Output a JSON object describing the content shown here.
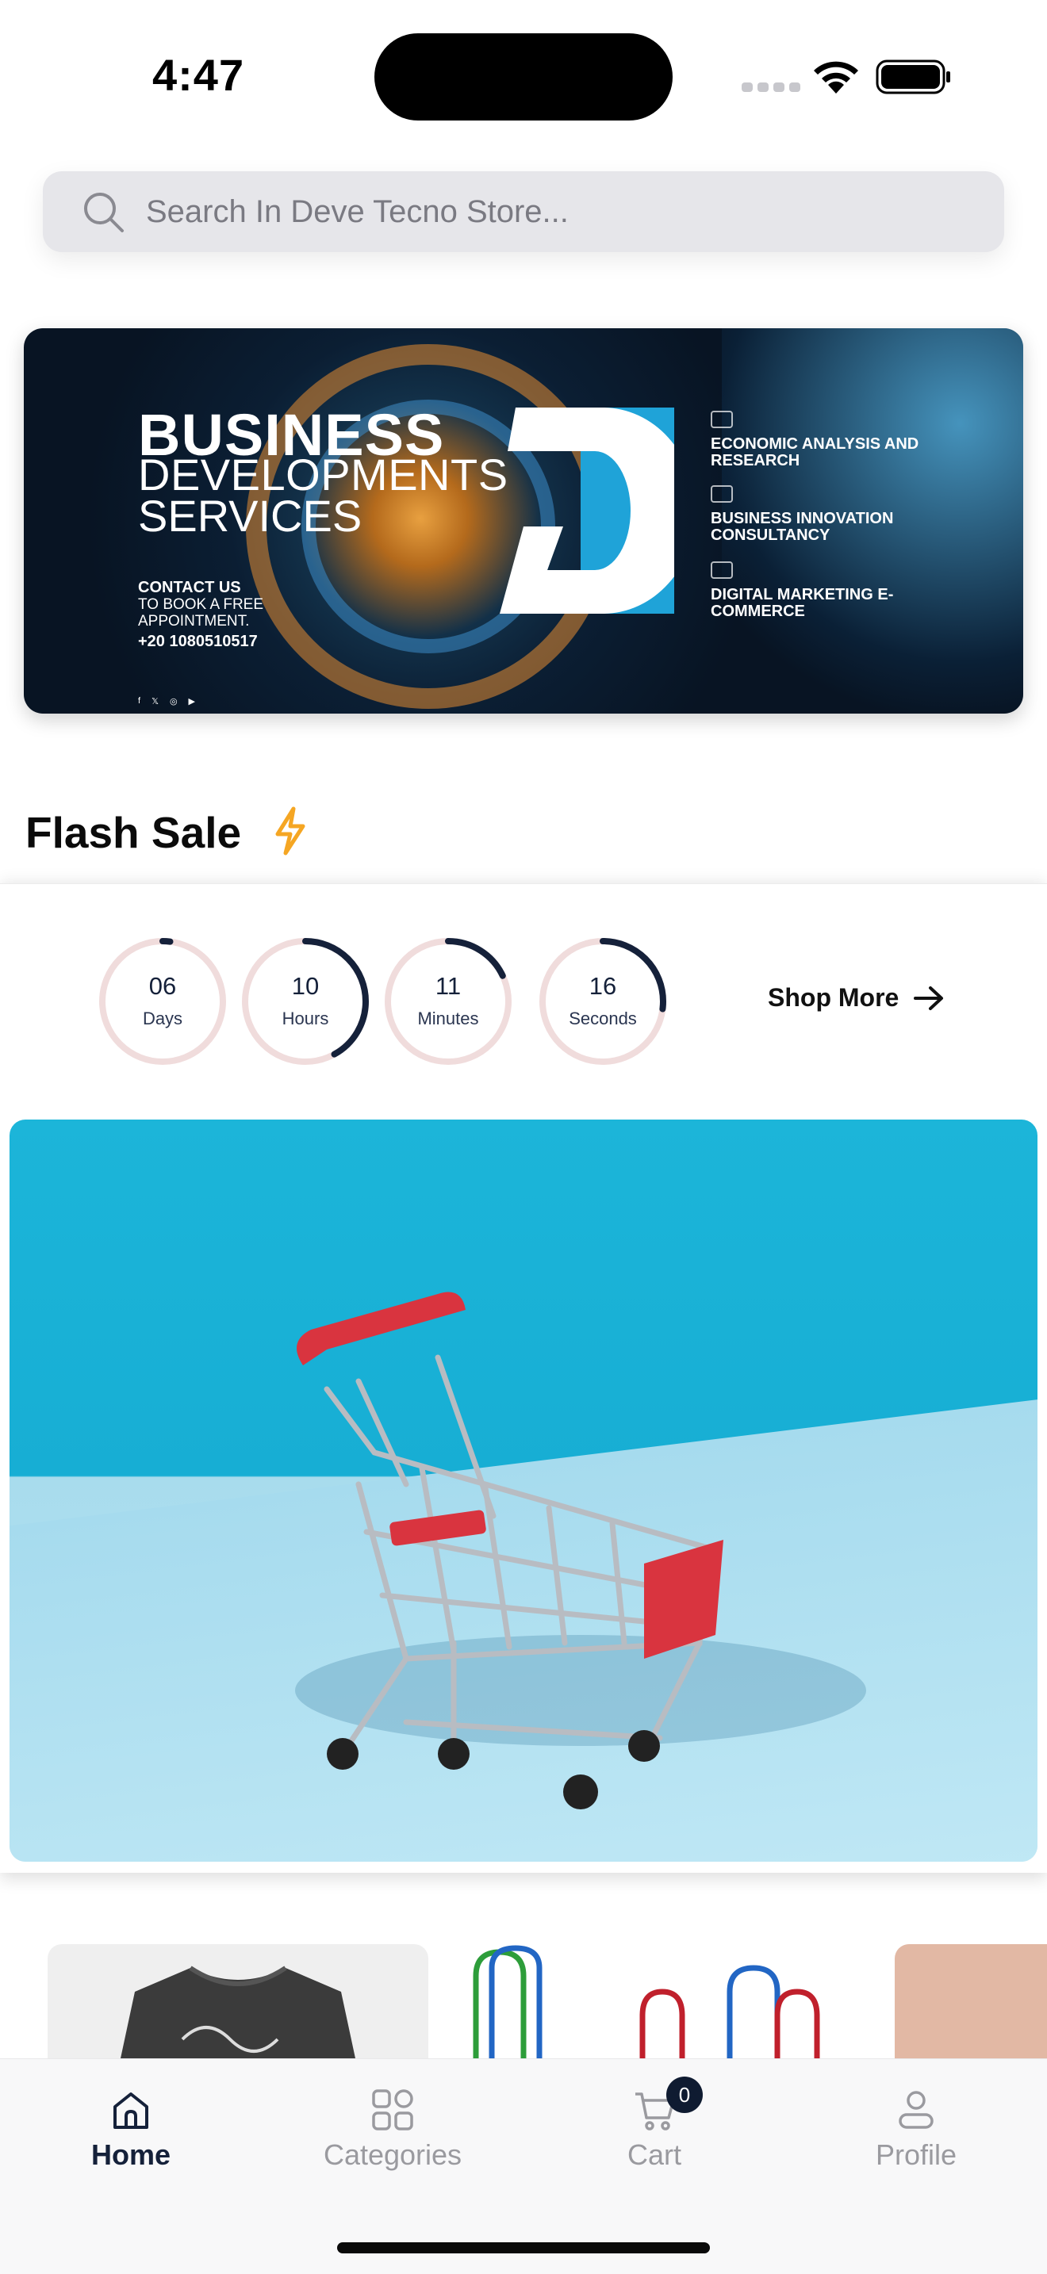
{
  "status_bar": {
    "time": "4:47"
  },
  "search": {
    "placeholder": "Search In Deve Tecno Store..."
  },
  "banner": {
    "title_line1": "BUSINESS",
    "title_line2": "DEVELOPMENTS",
    "title_line3": "SERVICES",
    "contact_heading": "CONTACT US",
    "contact_text": "TO BOOK A FREE APPOINTMENT.",
    "phone": "+20 1080510517",
    "social_icons": [
      "facebook-icon",
      "x-icon",
      "instagram-icon",
      "youtube-icon"
    ],
    "services": [
      "ECONOMIC ANALYSIS AND RESEARCH",
      "BUSINESS INNOVATION CONSULTANCY",
      "DIGITAL MARKETING E-COMMERCE"
    ]
  },
  "flash_sale": {
    "title": "Flash Sale",
    "icon": "lightning-bolt-icon",
    "timer": [
      {
        "value": "06",
        "unit": "Days",
        "progress": 0.02
      },
      {
        "value": "10",
        "unit": "Hours",
        "progress": 0.42
      },
      {
        "value": "11",
        "unit": "Minutes",
        "progress": 0.18
      },
      {
        "value": "16",
        "unit": "Seconds",
        "progress": 0.27
      }
    ],
    "shop_more_label": "Shop More"
  },
  "tab_bar": {
    "tabs": [
      {
        "label": "Home",
        "icon": "home-icon",
        "active": true
      },
      {
        "label": "Categories",
        "icon": "grid-icon",
        "active": false
      },
      {
        "label": "Cart",
        "icon": "cart-icon",
        "active": false
      },
      {
        "label": "Profile",
        "icon": "person-icon",
        "active": false
      }
    ],
    "cart_count": "0"
  },
  "colors": {
    "accent_dark": "#15213a",
    "bolt": "#f5a623",
    "timer_track": "#f0dcdc",
    "hero_blue": "#1cb5d9"
  }
}
